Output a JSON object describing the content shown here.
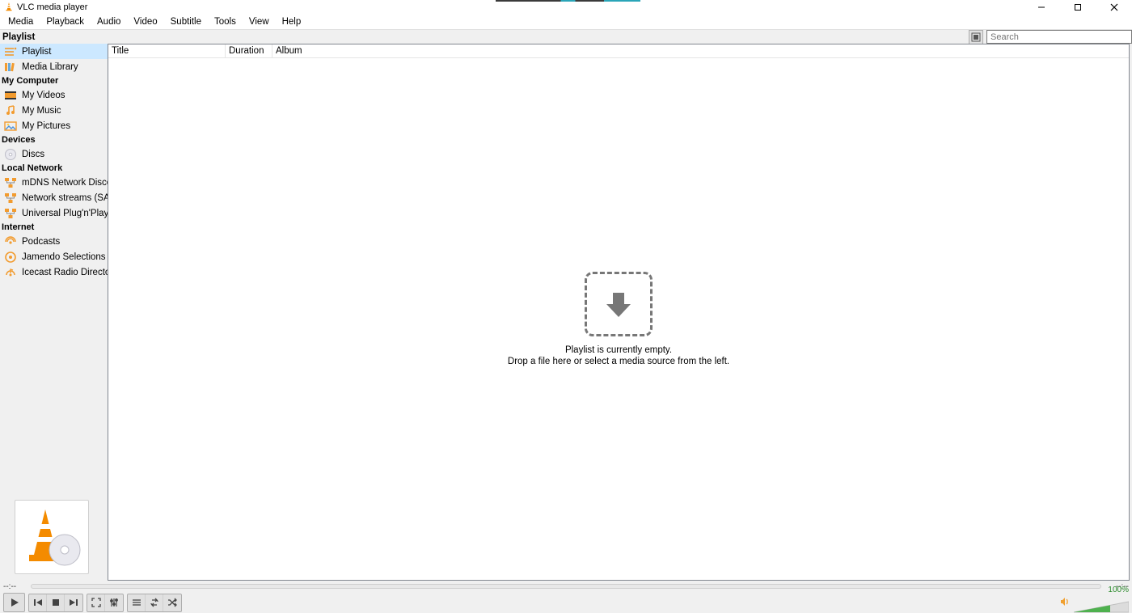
{
  "titlebar": {
    "title": "VLC media player"
  },
  "menu": {
    "items": [
      "Media",
      "Playback",
      "Audio",
      "Video",
      "Subtitle",
      "Tools",
      "View",
      "Help"
    ]
  },
  "toprow": {
    "playlist_label": "Playlist",
    "search_placeholder": "Search"
  },
  "sidebar": {
    "sections": [
      {
        "name": "",
        "items": [
          {
            "label": "Playlist",
            "icon": "playlist",
            "selected": true
          },
          {
            "label": "Media Library",
            "icon": "library"
          }
        ]
      },
      {
        "name": "My Computer",
        "items": [
          {
            "label": "My Videos",
            "icon": "video"
          },
          {
            "label": "My Music",
            "icon": "music"
          },
          {
            "label": "My Pictures",
            "icon": "pictures"
          }
        ]
      },
      {
        "name": "Devices",
        "items": [
          {
            "label": "Discs",
            "icon": "disc"
          }
        ]
      },
      {
        "name": "Local Network",
        "items": [
          {
            "label": "mDNS Network Discovery",
            "icon": "net"
          },
          {
            "label": "Network streams (SAP)",
            "icon": "net"
          },
          {
            "label": "Universal Plug'n'Play",
            "icon": "net"
          }
        ]
      },
      {
        "name": "Internet",
        "items": [
          {
            "label": "Podcasts",
            "icon": "podcast"
          },
          {
            "label": "Jamendo Selections",
            "icon": "jamendo"
          },
          {
            "label": "Icecast Radio Directory",
            "icon": "icecast"
          }
        ]
      }
    ]
  },
  "playlist": {
    "columns": {
      "title": "Title",
      "duration": "Duration",
      "album": "Album"
    },
    "empty_line1": "Playlist is currently empty.",
    "empty_line2": "Drop a file here or select a media source from the left."
  },
  "seek": {
    "elapsed": "--:--",
    "remaining": "--:--"
  },
  "volume": {
    "percent_label": "100%"
  }
}
